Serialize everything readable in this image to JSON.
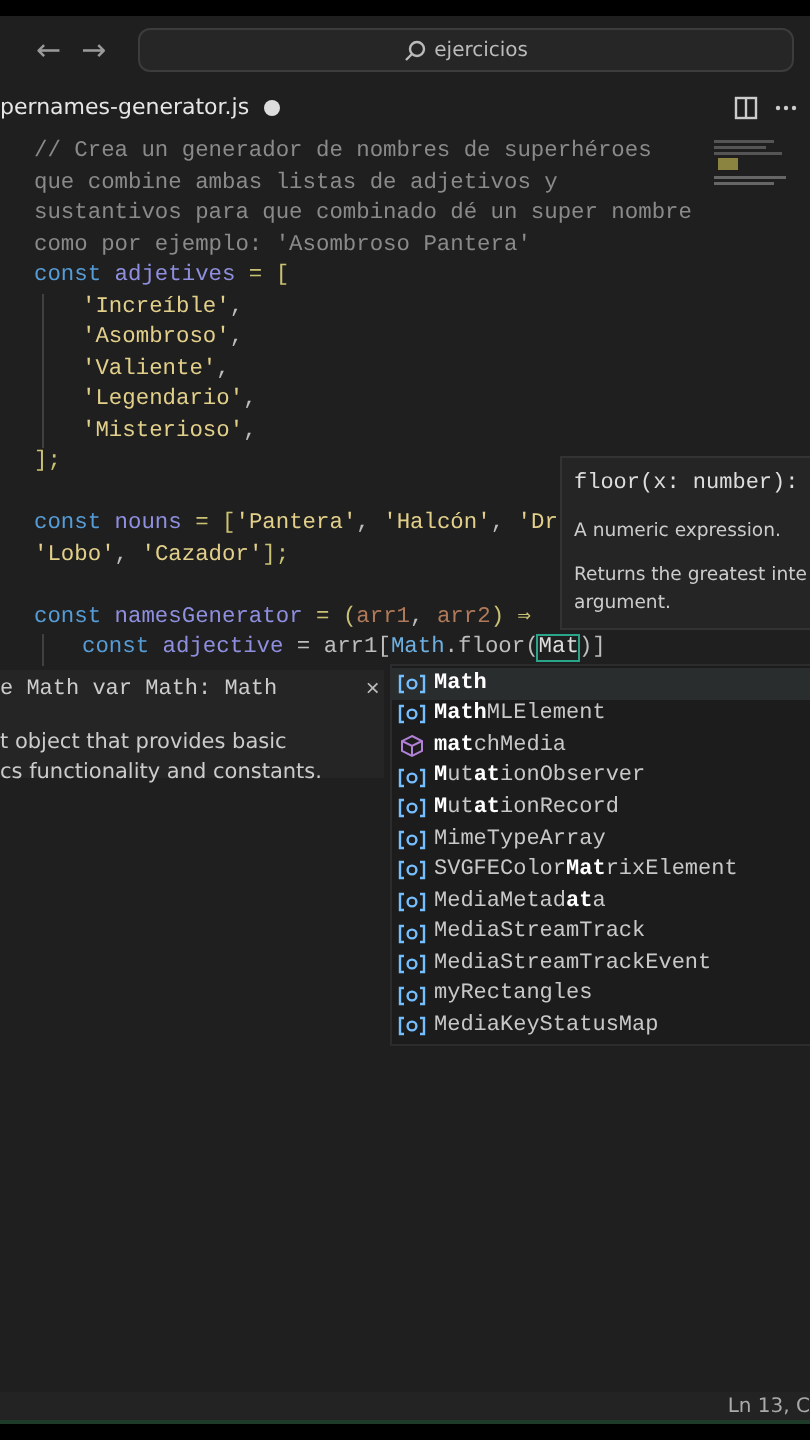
{
  "title_bar": {
    "back": "←",
    "forward": "→",
    "search": "ejercicios"
  },
  "tab": {
    "label": "pernames-generator.js",
    "modified": true
  },
  "code_lines": [
    {
      "tokens": [
        {
          "kind": "comment",
          "text": "// Crea un generador de nombres de superhéroes"
        }
      ]
    },
    {
      "tokens": [
        {
          "kind": "comment",
          "text": "que combine ambas listas de adjetivos y"
        }
      ]
    },
    {
      "tokens": [
        {
          "kind": "comment",
          "text": "sustantivos para que combinado dé un super nombre"
        }
      ]
    },
    {
      "tokens": [
        {
          "kind": "comment",
          "text": "como por ejemplo: 'Asombroso Pantera'"
        }
      ]
    },
    {
      "tokens": [
        {
          "kind": "keyword",
          "text": "const"
        },
        {
          "kind": "variable",
          "text": " adjetives"
        },
        {
          "kind": "punct",
          "text": " = ["
        }
      ]
    },
    {
      "indented": true,
      "tokens": [
        {
          "kind": "string",
          "text": "'Increíble'"
        },
        {
          "kind": "plain",
          "text": ","
        }
      ]
    },
    {
      "indented": true,
      "tokens": [
        {
          "kind": "string",
          "text": "'Asombroso'"
        },
        {
          "kind": "plain",
          "text": ","
        }
      ]
    },
    {
      "indented": true,
      "tokens": [
        {
          "kind": "string",
          "text": "'Valiente'"
        },
        {
          "kind": "plain",
          "text": ","
        }
      ]
    },
    {
      "indented": true,
      "tokens": [
        {
          "kind": "string",
          "text": "'Legendario'"
        },
        {
          "kind": "plain",
          "text": ","
        }
      ]
    },
    {
      "indented": true,
      "tokens": [
        {
          "kind": "string",
          "text": "'Misterioso'"
        },
        {
          "kind": "plain",
          "text": ","
        }
      ]
    },
    {
      "tokens": [
        {
          "kind": "punct",
          "text": "];"
        }
      ]
    },
    {
      "blank_line_before": true,
      "tokens": [
        {
          "kind": "keyword",
          "text": "const"
        },
        {
          "kind": "variable",
          "text": " nouns"
        },
        {
          "kind": "punct",
          "text": " = ["
        },
        {
          "kind": "string",
          "text": "'Pantera'"
        },
        {
          "kind": "plain",
          "text": ", "
        },
        {
          "kind": "string",
          "text": "'Halcón'"
        },
        {
          "kind": "plain",
          "text": ", "
        },
        {
          "kind": "string",
          "text": "'Dr"
        }
      ]
    },
    {
      "tokens": [
        {
          "kind": "string",
          "text": "'Lobo'"
        },
        {
          "kind": "plain",
          "text": ", "
        },
        {
          "kind": "string",
          "text": "'Cazador'"
        },
        {
          "kind": "punct",
          "text": "];"
        }
      ]
    },
    {
      "blank_line_before": true,
      "tokens": [
        {
          "kind": "keyword",
          "text": "const"
        },
        {
          "kind": "function",
          "text": " namesGenerator"
        },
        {
          "kind": "punct",
          "text": " = ("
        },
        {
          "kind": "param",
          "text": "arr1"
        },
        {
          "kind": "plain",
          "text": ", "
        },
        {
          "kind": "param",
          "text": "arr2"
        },
        {
          "kind": "punct",
          "text": ") ⇒"
        }
      ]
    },
    {
      "indented": true,
      "tokens": [
        {
          "kind": "keyword",
          "text": "const"
        },
        {
          "kind": "variable",
          "text": " adjective"
        },
        {
          "kind": "plain",
          "text": " = arr1["
        },
        {
          "kind": "object",
          "text": "Math"
        },
        {
          "kind": "plain",
          "text": ".floor("
        },
        {
          "kind": "typing",
          "text": "Mat"
        },
        {
          "kind": "plain",
          "text": ")]"
        }
      ]
    }
  ],
  "signature_help": {
    "signature": "floor(x: number):",
    "param_doc": "A numeric expression.",
    "description": "Returns the greatest inte",
    "description_2": "argument."
  },
  "hover": {
    "signature": "e Math var Math: Math",
    "close": "×",
    "lines": [
      "t object that provides basic",
      "cs functionality and constants."
    ]
  },
  "suggestions": [
    {
      "label": "**Math**",
      "kind": "variable",
      "selected": true
    },
    {
      "label": "**Math**MLElement",
      "kind": "variable",
      "selected": false
    },
    {
      "label": "**mat**chMedia",
      "kind": "method",
      "selected": false
    },
    {
      "label": "**M**ut**at**ionObserver",
      "kind": "variable",
      "selected": false
    },
    {
      "label": "**M**ut**at**ionRecord",
      "kind": "variable",
      "selected": false
    },
    {
      "label": "MimeTypeArray",
      "kind": "variable",
      "selected": false
    },
    {
      "label": "SVGFEColor**Mat**rixElement",
      "kind": "variable",
      "selected": false
    },
    {
      "label": "MediaMetad**at**a",
      "kind": "variable",
      "selected": false
    },
    {
      "label": "MediaStreamTrack",
      "kind": "variable",
      "selected": false
    },
    {
      "label": "MediaStreamTrackEvent",
      "kind": "variable",
      "selected": false
    },
    {
      "label": "myRectangles",
      "kind": "variable",
      "selected": false
    },
    {
      "label": "MediaKeyStatusMap",
      "kind": "variable",
      "selected": false
    }
  ],
  "status_bar": {
    "position": "Ln 13, C"
  }
}
